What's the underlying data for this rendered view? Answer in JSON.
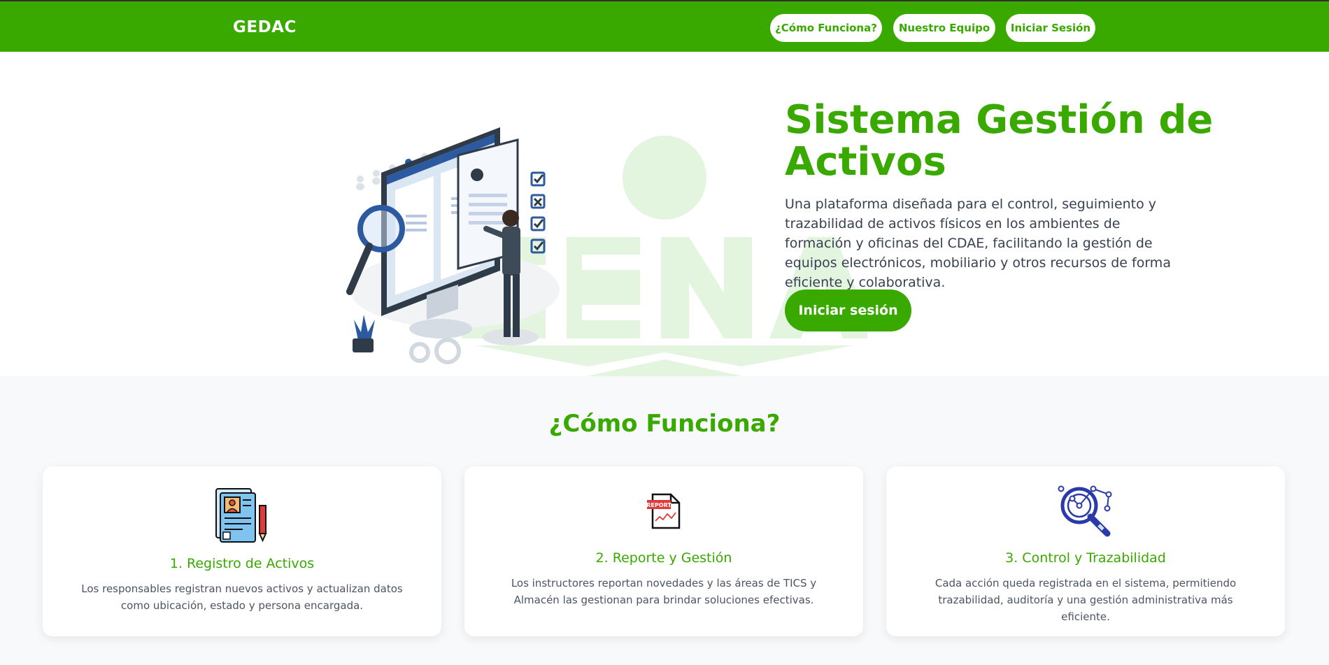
{
  "header": {
    "brand": "GEDAC",
    "nav": [
      {
        "label": "¿Cómo Funciona?"
      },
      {
        "label": "Nuestro Equipo"
      },
      {
        "label": "Iniciar Sesión"
      }
    ]
  },
  "hero": {
    "title": "Sistema Gestión de Activos",
    "description": "Una plataforma diseñada para el control, seguimiento y trazabilidad de activos físicos en los ambientes de formación y oficinas del CDAE, facilitando la gestión de equipos electrónicos, mobiliario y otros recursos de forma eficiente y colaborativa.",
    "button": "Iniciar sesión",
    "illustration_icon": "asset-management-illustration",
    "watermark_icon": "sena-logo-watermark"
  },
  "how": {
    "title": "¿Cómo Funciona?",
    "cards": [
      {
        "icon": "document-registry-icon",
        "title": "1. Registro de Activos",
        "text": "Los responsables registran nuevos activos y actualizan datos como ubicación, estado y persona encargada."
      },
      {
        "icon": "report-icon",
        "title": "2. Reporte y Gestión",
        "text": "Los instructores reportan novedades y las áreas de TICS y Almacén las gestionan para brindar soluciones efectivas."
      },
      {
        "icon": "magnifier-network-icon",
        "title": "3. Control y Trazabilidad",
        "text": "Cada acción queda registrada en el sistema, permitiendo trazabilidad, auditoría y una gestión administrativa más eficiente."
      }
    ]
  },
  "colors": {
    "brand_green": "#39a900",
    "watermark_green": "#e3f4df",
    "text_dark": "#374151",
    "section_bg": "#f8f9fb"
  }
}
